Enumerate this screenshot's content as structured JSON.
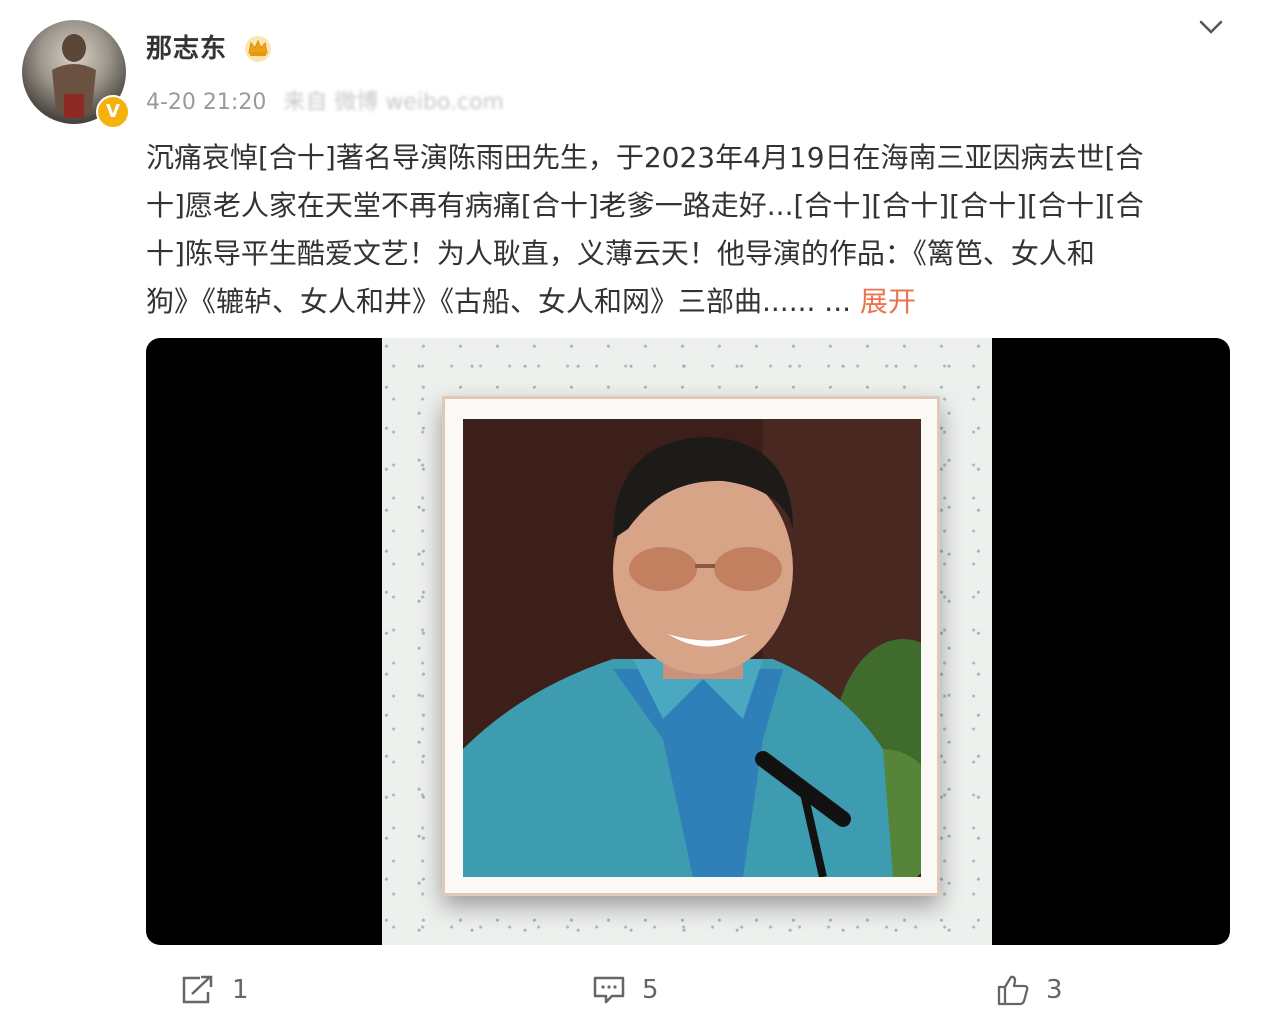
{
  "user": {
    "name": "那志东",
    "verified_badge": "V",
    "timestamp": "4-20 21:20",
    "source": "来自 微博 weibo.com"
  },
  "post": {
    "lines": [
      "沉痛哀悼[合十]著名导演陈雨田先生，于2023年4月19日在海南三亚因病去世[合",
      "十]愿老人家在天堂不再有病痛[合十]老爹一路走好...[合十][合十][合十][合十][合",
      "十]陈导平生酷爱文艺！为人耿直，义薄云天！他导演的作品：《篱笆、女人和",
      "狗》《辘轳、女人和井》《古船、女人和网》三部曲......    ..."
    ],
    "expand_label": "展开"
  },
  "actions": {
    "repost_count": "1",
    "comment_count": "5",
    "like_count": "3"
  },
  "icons": {
    "crown": "crown-icon",
    "chevron": "chevron-down-icon",
    "repost": "share-icon",
    "comment": "comment-icon",
    "like": "thumbs-up-icon"
  },
  "colors": {
    "accent": "#eb7350",
    "badge": "#f4b20a",
    "text": "#333333",
    "meta": "#9a9a9a"
  }
}
